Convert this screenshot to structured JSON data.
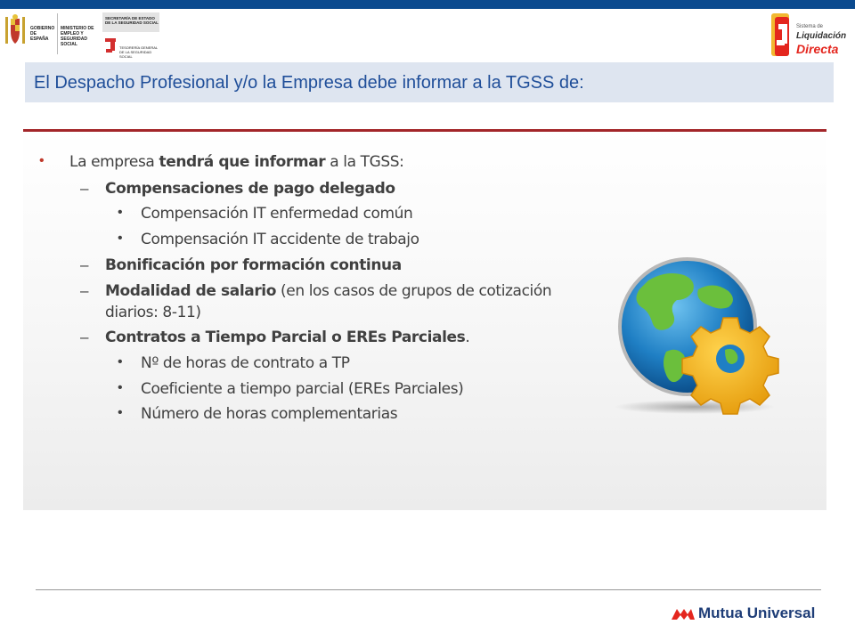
{
  "header": {
    "gov_logo": {
      "line1": "GOBIERNO DE ESPAÑA",
      "line2": "MINISTERIO DE EMPLEO Y SEGURIDAD SOCIAL",
      "line3": "SECRETARÍA DE ESTADO DE LA SEGURIDAD SOCIAL",
      "line4": "TESORERÍA GENERAL DE LA SEGURIDAD SOCIAL"
    },
    "sld_logo": {
      "small": "Sistema de",
      "mid": "Liquidación",
      "big": "Directa"
    }
  },
  "title": "El Despacho Profesional y/o la Empresa debe informar a la TGSS de:",
  "content": {
    "intro": {
      "pre": "La empresa ",
      "bold": "tendrá que informar",
      "post": " a la TGSS:"
    },
    "items": [
      {
        "level": 2,
        "bold": "Compensaciones de pago delegado",
        "text": ""
      },
      {
        "level": 3,
        "text": "Compensación IT enfermedad común"
      },
      {
        "level": 3,
        "text": "Compensación IT accidente de trabajo"
      },
      {
        "level": 2,
        "bold": "Bonificación por formación continua",
        "text": ""
      },
      {
        "level": 2,
        "bold": "Modalidad de salario",
        "text": " (en los casos de grupos de cotización",
        "text2": "diarios: 8-11)"
      },
      {
        "level": 2,
        "bold": "Contratos a Tiempo Parcial o EREs Parciales",
        "text": "."
      },
      {
        "level": 3,
        "text": "Nº de horas de contrato a TP"
      },
      {
        "level": 3,
        "text": "Coeficiente a tiempo parcial (EREs Parciales)"
      },
      {
        "level": 3,
        "text": "Número de horas complementarias"
      }
    ]
  },
  "footer": {
    "brand": "Mutua Universal"
  },
  "colors": {
    "topbar": "#0b4a8f",
    "title": "#1f4e99",
    "title_band": "#dee5f0",
    "rule": "#a3262a",
    "brand": "#1e3d77",
    "brand_mark": "#e4261e"
  },
  "icons": {
    "content_image": "globe-gear-icon"
  }
}
